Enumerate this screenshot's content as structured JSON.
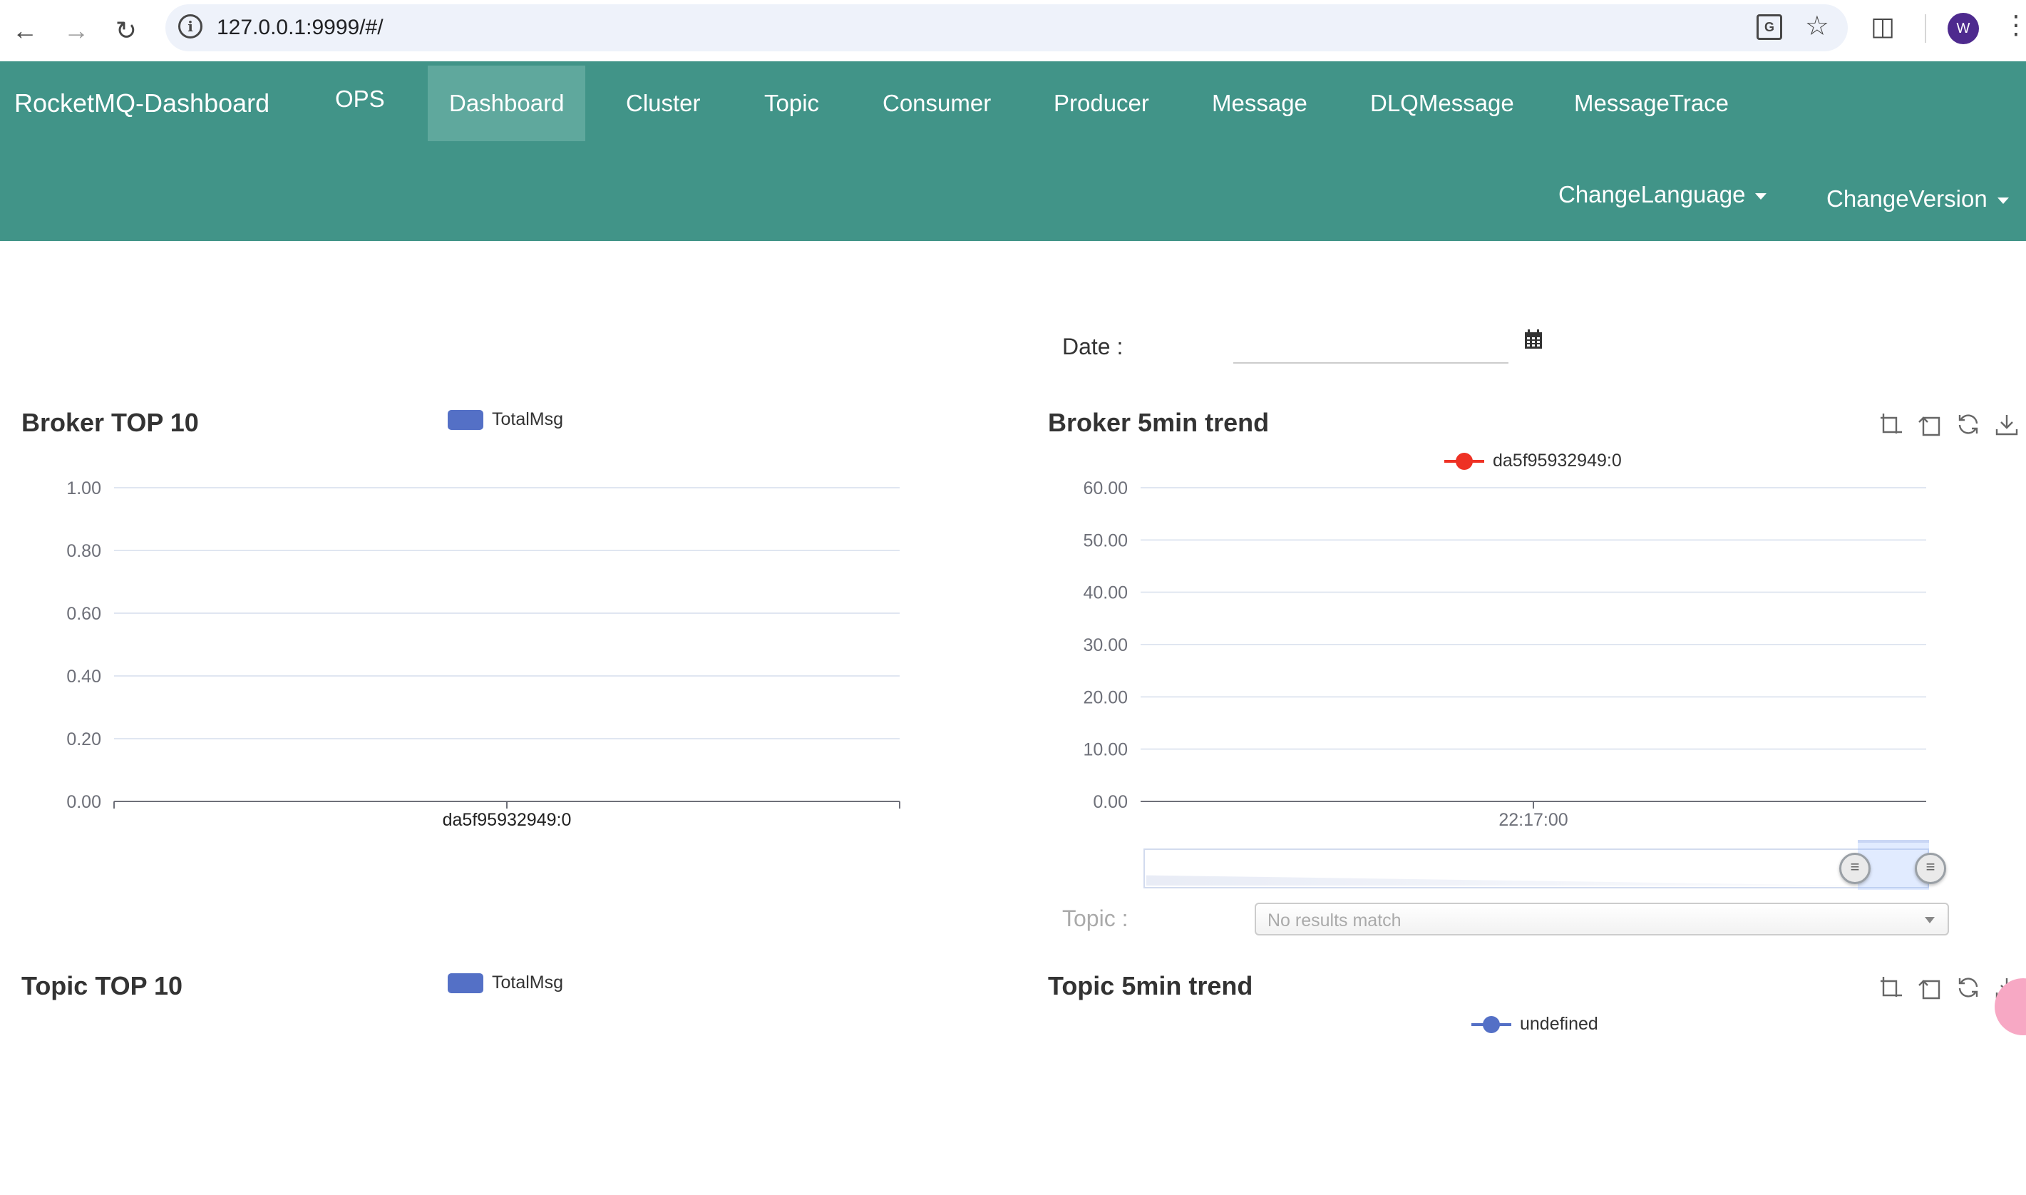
{
  "browser": {
    "url": "127.0.0.1:9999/#/",
    "avatar_letter": "W",
    "icons": [
      "back-arrow-icon",
      "forward-arrow-icon",
      "reload-icon",
      "site-info-icon",
      "translate-icon",
      "bookmark-star-icon",
      "extensions-puzzle-icon",
      "kebab-menu-icon"
    ]
  },
  "navbar": {
    "brand": "RocketMQ-Dashboard",
    "items": [
      {
        "label": "OPS",
        "active": false
      },
      {
        "label": "Dashboard",
        "active": true
      },
      {
        "label": "Cluster",
        "active": false
      },
      {
        "label": "Topic",
        "active": false
      },
      {
        "label": "Consumer",
        "active": false
      },
      {
        "label": "Producer",
        "active": false
      },
      {
        "label": "Message",
        "active": false
      },
      {
        "label": "DLQMessage",
        "active": false
      },
      {
        "label": "MessageTrace",
        "active": false
      }
    ],
    "change_language": "ChangeLanguage",
    "change_version": "ChangeVersion",
    "background_color": "#419488",
    "active_color": "#5fa89d"
  },
  "date_filter": {
    "label": "Date :",
    "value": "",
    "icon": "calendar-icon"
  },
  "topic_filter": {
    "label": "Topic :",
    "placeholder": "No results match"
  },
  "panels": {
    "broker_top10": {
      "title": "Broker TOP 10",
      "legend": "TotalMsg",
      "legend_color": "#5470c6"
    },
    "broker_trend": {
      "title": "Broker 5min trend",
      "legend": "da5f95932949:0",
      "legend_color": "#ee3124"
    },
    "topic_top10": {
      "title": "Topic TOP 10",
      "legend": "TotalMsg",
      "legend_color": "#5470c6"
    },
    "topic_trend": {
      "title": "Topic 5min trend",
      "legend": "undefined",
      "legend_color": "#5470c6"
    },
    "toolbox_icons": [
      "zoom-area-icon",
      "zoom-reset-icon",
      "restore-icon",
      "save-image-icon"
    ]
  },
  "chart_data": [
    {
      "type": "bar",
      "title": "Broker TOP 10",
      "categories": [
        "da5f95932949:0"
      ],
      "series": [
        {
          "name": "TotalMsg",
          "values": [
            0
          ]
        }
      ],
      "ylim": [
        0,
        1
      ],
      "yticks": [
        "0.00",
        "0.20",
        "0.40",
        "0.60",
        "0.80",
        "1.00"
      ],
      "grid": true,
      "legend_position": "top-center"
    },
    {
      "type": "line",
      "title": "Broker 5min trend",
      "x": [
        "22:17:00"
      ],
      "series": [
        {
          "name": "da5f95932949:0",
          "values": [
            0
          ]
        }
      ],
      "ylim": [
        0,
        60
      ],
      "yticks": [
        "0.00",
        "10.00",
        "20.00",
        "30.00",
        "40.00",
        "50.00",
        "60.00"
      ],
      "grid": true,
      "legend_position": "top-center",
      "data_zoom_range": [
        90,
        100
      ]
    },
    {
      "type": "bar",
      "title": "Topic TOP 10",
      "categories": [],
      "series": [
        {
          "name": "TotalMsg",
          "values": []
        }
      ],
      "legend_position": "top-center"
    },
    {
      "type": "line",
      "title": "Topic 5min trend",
      "x": [],
      "series": [
        {
          "name": "undefined",
          "values": []
        }
      ],
      "legend_position": "top-center"
    }
  ]
}
